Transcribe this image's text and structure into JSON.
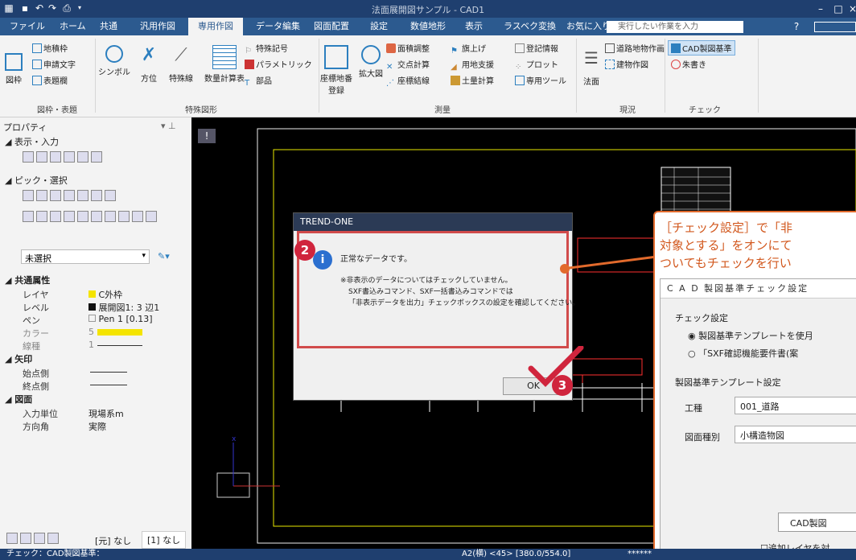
{
  "app": {
    "title": "法面展開図サンプル - CAD1"
  },
  "menu": {
    "items": [
      "ファイル",
      "ホーム",
      "共通",
      "汎用作図",
      "専用作図",
      "データ編集",
      "図面配置",
      "設定",
      "数値地形",
      "表示",
      "ラスベク変換",
      "お気に入り"
    ],
    "active_index": 4,
    "search_placeholder": "実行したい作業を入力"
  },
  "ribbon": {
    "g1": {
      "btn_zuwaku": "図枠",
      "chiseki": "地積枠",
      "shinsei": "申請文字",
      "hyodai": "表題欄",
      "label": "図枠・表題"
    },
    "g2": {
      "symbol": "シンボル",
      "houi": "方位",
      "tokushusen": "特殊線",
      "suryo": "数量計算表",
      "tokushu_kigo": "特殊記号",
      "parametric": "パラメトリック",
      "buhin": "部品",
      "label": "特殊図形"
    },
    "g3": {
      "zahyo": "座標地番\n登録",
      "kakudai": "拡大図",
      "menseki": "面積調整",
      "koten": "交点計算",
      "zahyo_kessen": "座標結線",
      "hataage": "旗上げ",
      "yochi": "用地支援",
      "dosuryo": "土量計算",
      "toki": "登記情報",
      "plot": "プロット",
      "senyo": "専用ツール",
      "label": "測量"
    },
    "g4": {
      "norimen": "法面",
      "doro": "道路地物作画",
      "tatemono": "建物作図",
      "label": "現況"
    },
    "g5": {
      "cad": "CAD製図基準",
      "shugaki": "朱書き",
      "label": "チェック"
    }
  },
  "props": {
    "title": "プロパティ",
    "sec_display": "表示・入力",
    "sec_pick": "ピック・選択",
    "select": "未選択",
    "common": "共通属性",
    "rows": [
      {
        "label": "レイヤ",
        "value": "C外枠"
      },
      {
        "label": "レベル",
        "value": "展開図1: 3 辺1"
      },
      {
        "label": "ペン",
        "value": "Pen 1 [0.13]"
      },
      {
        "label": "カラー",
        "value": "5"
      },
      {
        "label": "線種",
        "value": "1"
      }
    ],
    "arrow": "矢印",
    "arrow_rows": [
      {
        "label": "始点側"
      },
      {
        "label": "終点側"
      }
    ],
    "drawing": "図面",
    "drawing_rows": [
      {
        "label": "入力単位",
        "value": "現場系m"
      },
      {
        "label": "方向角",
        "value": "実際"
      }
    ],
    "tabs": [
      "[元] なし",
      "[1] なし"
    ]
  },
  "dialog": {
    "title": "TREND-ONE",
    "line1": "正常なデータです。",
    "line2": "※非表示のデータについてはチェックしていません。",
    "line3": "SXF書込みコマンド、SXF一括書込みコマンドでは",
    "line4": "「非表示データを出力」チェックボックスの設定を確認してください。",
    "ok": "OK"
  },
  "callout": {
    "l1": "［チェック設定］で「非",
    "l2": "対象とする」をオンにて",
    "l3": "ついてもチェックを行い"
  },
  "cad": {
    "title": "C A D 製図基準チェック設定",
    "check": "チェック設定",
    "opt1": "製図基準テンプレートを使月",
    "opt2": "「SXF確認機能要件書(案",
    "tmpl": "製図基準テンプレート設定",
    "koshu_label": "工種",
    "koshu": "001_道路",
    "zumen_label": "図面種別",
    "zumen": "小構造物図",
    "btn": "CAD製図",
    "extra": "追加レイヤを対"
  },
  "status": {
    "left": "チェック：CAD製図基準：",
    "mid": "A2(横)  <45>  [380.0/554.0]",
    "right": "******"
  },
  "badges": {
    "b2": "2",
    "b3": "3"
  },
  "colors": {
    "accent": "#2c5a8f",
    "title": "#1f3f6f",
    "callout": "#e26a2c",
    "badge": "#d0253d"
  }
}
